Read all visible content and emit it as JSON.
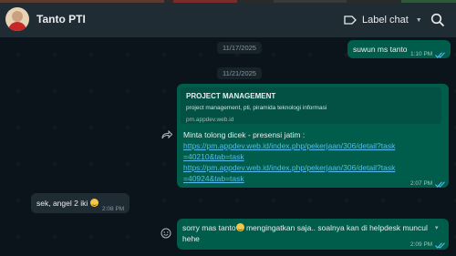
{
  "colors": {
    "header_bg": "#202c33",
    "chat_bg": "#0b141a",
    "outgoing_bubble": "#005c4b",
    "incoming_bubble": "#202c33",
    "link": "#53bdeb",
    "tick_read": "#53bdeb"
  },
  "header": {
    "contact_name": "Tanto PTI",
    "label_chat": "Label chat",
    "icons": [
      "avatar",
      "label-icon",
      "caret-down-icon",
      "search-icon"
    ]
  },
  "dates": {
    "first": "11/17/2025",
    "second": "11/21/2025"
  },
  "messages": {
    "m1": {
      "text": "suwun ms tanto",
      "time": "1:10 PM"
    },
    "m2": {
      "preview": {
        "title": "PROJECT MANAGEMENT",
        "desc": "project management, pti, piramida teknologi informasi",
        "url": "pm.appdev.web.id"
      },
      "intro": "Minta tolong dicek - presensi jatim :",
      "link1": "https://pm.appdev.web.id/index.php/pekerjaan/306/detail?task=40210&tab=task",
      "link2": "https://pm.appdev.web.id/index.php/pekerjaan/306/detail?task=40924&tab=task",
      "time": "2:07 PM"
    },
    "m3": {
      "text": "sek, angel 2 iki",
      "time": "2:08 PM"
    },
    "m4": {
      "text_a": "sorry mas tanto",
      "text_b": " mengingatkan saja.. soalnya kan di helpdesk muncul hehe",
      "time": "2:09 PM"
    }
  }
}
